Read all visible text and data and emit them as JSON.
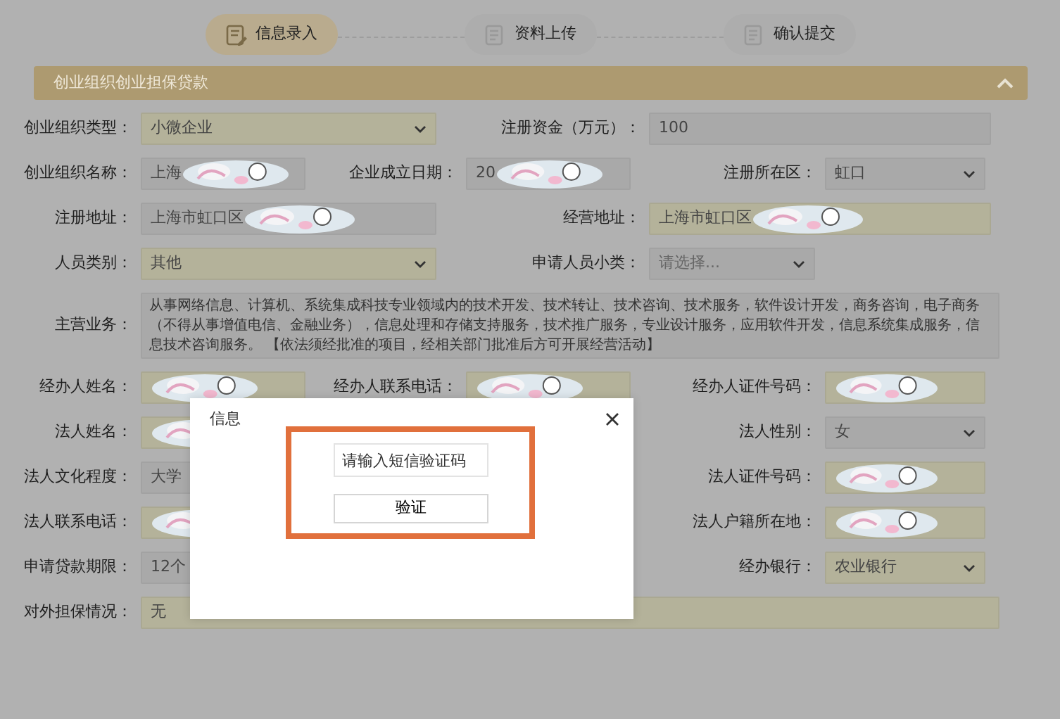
{
  "steps": [
    {
      "label": "信息录入",
      "selected": true
    },
    {
      "label": "资料上传",
      "selected": false
    },
    {
      "label": "确认提交",
      "selected": false
    }
  ],
  "section": {
    "title": "创业组织创业担保贷款",
    "expanded": true
  },
  "rows": [
    {
      "fields": [
        {
          "label": "创业组织类型：",
          "kind": "select",
          "value": "小微企业",
          "readonly": false
        },
        {
          "label": "注册资金（万元）：",
          "kind": "input",
          "value": "100",
          "readonly": true
        }
      ]
    },
    {
      "fields": [
        {
          "label": "创业组织名称：",
          "kind": "input",
          "value": "上海",
          "redacted": true,
          "readonly": true
        },
        {
          "label": "企业成立日期：",
          "kind": "input",
          "value": "20",
          "redacted": true,
          "readonly": true
        },
        {
          "label": "注册所在区：",
          "kind": "select",
          "value": "虹口",
          "readonly": true
        }
      ]
    },
    {
      "fields": [
        {
          "label": "注册地址：",
          "kind": "input",
          "value": "上海市虹口区",
          "redacted": true,
          "readonly": true
        },
        {
          "label": "经营地址：",
          "kind": "input",
          "value": "上海市虹口区",
          "redacted": true,
          "readonly": false
        }
      ]
    },
    {
      "fields": [
        {
          "label": "人员类别：",
          "kind": "select",
          "value": "其他",
          "readonly": false
        },
        {
          "label": "申请人员小类：",
          "kind": "select",
          "placeholder": "请选择...",
          "readonly": true
        }
      ]
    },
    {
      "fields": [
        {
          "label": "主营业务：",
          "kind": "textarea",
          "value": "从事网络信息、计算机、系统集成科技专业领域内的技术开发、技术转让、技术咨询、技术服务，软件设计开发，商务咨询，电子商务（不得从事增值电信、金融业务），信息处理和存储支持服务，技术推广服务，专业设计服务，应用软件开发，信息系统集成服务，信息技术咨询服务。 【依法须经批准的项目，经相关部门批准后方可开展经营活动】",
          "readonly": true
        }
      ]
    },
    {
      "fields": [
        {
          "label": "经办人姓名：",
          "kind": "input",
          "redacted": true,
          "readonly": false
        },
        {
          "label": "经办人联系电话：",
          "kind": "input",
          "redacted": true,
          "readonly": false
        },
        {
          "label": "经办人证件号码：",
          "kind": "input",
          "redacted": true,
          "readonly": false
        }
      ]
    },
    {
      "left": {
        "label": "法人姓名：",
        "kind": "input",
        "redacted": true,
        "readonly": false
      },
      "right": {
        "label": "法人性别：",
        "kind": "select",
        "value": "女",
        "readonly": true
      }
    },
    {
      "left": {
        "label": "法人文化程度：",
        "kind": "input",
        "value": "大学",
        "readonly": true
      },
      "right": {
        "label": "法人证件号码：",
        "kind": "input",
        "redacted": true,
        "readonly": false
      }
    },
    {
      "left": {
        "label": "法人联系电话：",
        "kind": "input",
        "redacted": true,
        "readonly": false
      },
      "right": {
        "label": "法人户籍所在地：",
        "kind": "input",
        "redacted": true,
        "readonly": false
      }
    },
    {
      "left": {
        "label": "申请贷款期限：",
        "kind": "input",
        "value": "12个",
        "readonly": true
      },
      "right": {
        "label": "经办银行：",
        "kind": "select",
        "value": "农业银行",
        "readonly": false
      }
    },
    {
      "fields": [
        {
          "label": "对外担保情况：",
          "kind": "input",
          "value": "无",
          "readonly": false
        }
      ]
    }
  ],
  "dialog": {
    "title": "信息",
    "code_field": {
      "placeholder": "请输入短信验证码"
    },
    "button": "验证"
  }
}
